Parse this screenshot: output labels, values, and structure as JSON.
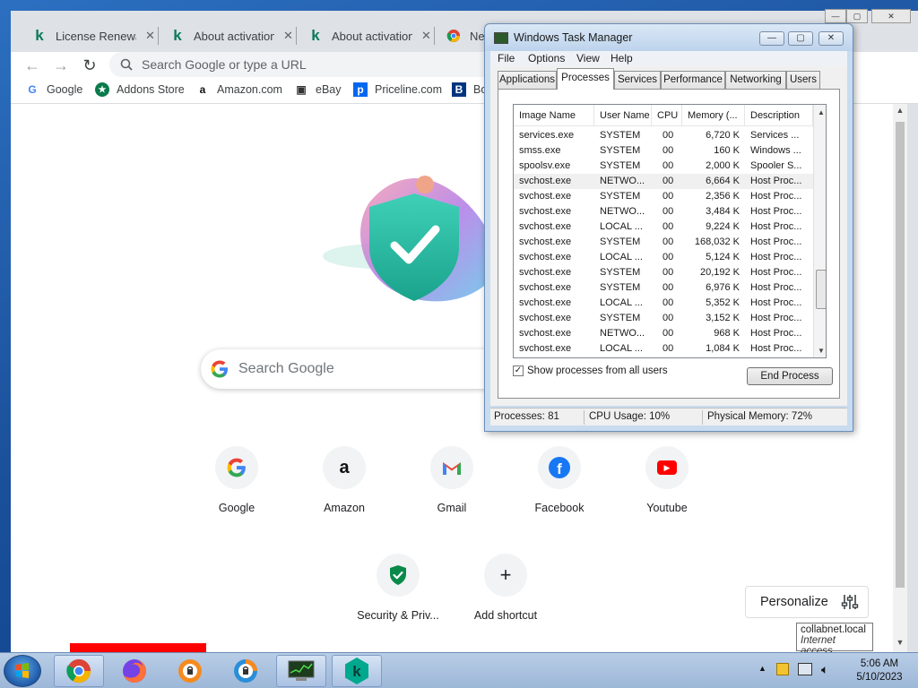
{
  "browser": {
    "tabs": [
      {
        "title": "License Renewal",
        "favicon": "kaspersky-k"
      },
      {
        "title": "About activation",
        "favicon": "kaspersky-k"
      },
      {
        "title": "About activation",
        "favicon": "kaspersky-k"
      },
      {
        "title": "Ne",
        "favicon": "chrome"
      }
    ],
    "omnibox_placeholder": "Search Google or type a URL",
    "bookmarks": [
      {
        "label": "Google",
        "icon": "google-g"
      },
      {
        "label": "Addons Store",
        "icon": "addons-star"
      },
      {
        "label": "Amazon.com",
        "icon": "amazon-a"
      },
      {
        "label": "eBay",
        "icon": "ebay-bag"
      },
      {
        "label": "Priceline.com",
        "icon": "priceline-p"
      },
      {
        "label": "Bo",
        "icon": "booking-b"
      }
    ]
  },
  "newtab": {
    "search_placeholder": "Search Google",
    "shortcuts": [
      {
        "label": "Google",
        "icon": "google-g"
      },
      {
        "label": "Amazon",
        "icon": "amazon-a"
      },
      {
        "label": "Gmail",
        "icon": "gmail-m"
      },
      {
        "label": "Facebook",
        "icon": "facebook-f"
      },
      {
        "label": "Youtube",
        "icon": "youtube-play"
      },
      {
        "label": "Security & Priv...",
        "icon": "shield-check"
      },
      {
        "label": "Add shortcut",
        "icon": "plus"
      }
    ],
    "personalize_label": "Personalize"
  },
  "taskmanager": {
    "title": "Windows Task Manager",
    "menu": [
      "File",
      "Options",
      "View",
      "Help"
    ],
    "tabs": [
      "Applications",
      "Processes",
      "Services",
      "Performance",
      "Networking",
      "Users"
    ],
    "active_tab": "Processes",
    "columns": [
      "Image Name",
      "User Name",
      "CPU",
      "Memory (...",
      "Description"
    ],
    "rows": [
      {
        "image": "services.exe",
        "user": "SYSTEM",
        "cpu": "00",
        "mem": "6,720 K",
        "desc": "Services ..."
      },
      {
        "image": "smss.exe",
        "user": "SYSTEM",
        "cpu": "00",
        "mem": "160 K",
        "desc": "Windows ..."
      },
      {
        "image": "spoolsv.exe",
        "user": "SYSTEM",
        "cpu": "00",
        "mem": "2,000 K",
        "desc": "Spooler S..."
      },
      {
        "image": "svchost.exe",
        "user": "NETWO...",
        "cpu": "00",
        "mem": "6,664 K",
        "desc": "Host Proc..."
      },
      {
        "image": "svchost.exe",
        "user": "SYSTEM",
        "cpu": "00",
        "mem": "2,356 K",
        "desc": "Host Proc..."
      },
      {
        "image": "svchost.exe",
        "user": "NETWO...",
        "cpu": "00",
        "mem": "3,484 K",
        "desc": "Host Proc..."
      },
      {
        "image": "svchost.exe",
        "user": "LOCAL ...",
        "cpu": "00",
        "mem": "9,224 K",
        "desc": "Host Proc..."
      },
      {
        "image": "svchost.exe",
        "user": "SYSTEM",
        "cpu": "00",
        "mem": "168,032 K",
        "desc": "Host Proc..."
      },
      {
        "image": "svchost.exe",
        "user": "LOCAL ...",
        "cpu": "00",
        "mem": "5,124 K",
        "desc": "Host Proc..."
      },
      {
        "image": "svchost.exe",
        "user": "SYSTEM",
        "cpu": "00",
        "mem": "20,192 K",
        "desc": "Host Proc..."
      },
      {
        "image": "svchost.exe",
        "user": "SYSTEM",
        "cpu": "00",
        "mem": "6,976 K",
        "desc": "Host Proc..."
      },
      {
        "image": "svchost.exe",
        "user": "LOCAL ...",
        "cpu": "00",
        "mem": "5,352 K",
        "desc": "Host Proc..."
      },
      {
        "image": "svchost.exe",
        "user": "SYSTEM",
        "cpu": "00",
        "mem": "3,152 K",
        "desc": "Host Proc..."
      },
      {
        "image": "svchost.exe",
        "user": "NETWO...",
        "cpu": "00",
        "mem": "968 K",
        "desc": "Host Proc..."
      },
      {
        "image": "svchost.exe",
        "user": "LOCAL ...",
        "cpu": "00",
        "mem": "1,084 K",
        "desc": "Host Proc..."
      }
    ],
    "selected_row": 3,
    "show_all_label": "Show processes from all users",
    "show_all_checked": true,
    "end_process_label": "End Process",
    "status": {
      "processes": "Processes: 81",
      "cpu": "CPU Usage: 10%",
      "memory": "Physical Memory: 72%"
    }
  },
  "tooltip": {
    "line1": "collabnet.local",
    "line2": "Internet access"
  },
  "taskbar": {
    "apps": [
      "chrome-icon",
      "firefox-icon",
      "avast-browser-icon",
      "avast-secure-browser-icon",
      "task-manager-icon",
      "kaspersky-icon"
    ],
    "time": "5:06 AM",
    "date": "5/10/2023"
  }
}
